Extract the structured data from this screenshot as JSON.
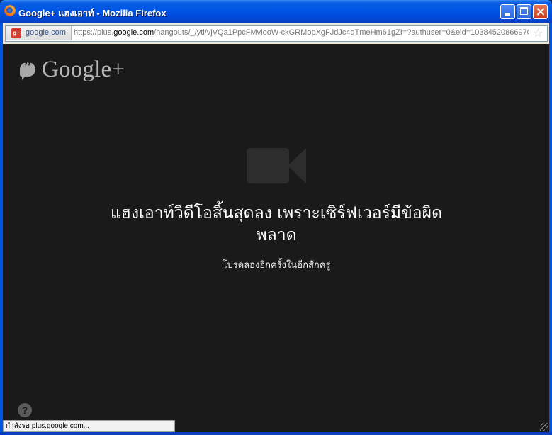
{
  "window": {
    "title": "Google+ แฮงเอาท์ - Mozilla Firefox",
    "minimize_icon": "minimize-icon",
    "maximize_icon": "maximize-icon",
    "close_icon": "close-icon"
  },
  "urlbar": {
    "site_identity": "google.com",
    "url_prefix": "https://plus.",
    "url_domain": "google.com",
    "url_suffix": "/hangouts/_/ytl/vjVQa1PpcFMvlooW-ckGRMopXgFJdJc4qTmeHm61gZI=?authuser=0&eid=103845208669705",
    "favicon_icon": "google-plus-favicon",
    "bookmark_icon": "star-icon"
  },
  "content": {
    "logo_text": "Google+",
    "logo_icon": "hangouts-quote-icon",
    "camera_icon": "video-camera-icon",
    "headline": "แฮงเอาท์วิดีโอสิ้นสุดลง เพราะเซิร์ฟเวอร์มีข้อผิดพลาด",
    "subline": "โปรดลองอีกครั้งในอีกสักครู่",
    "help_icon": "question-mark-icon",
    "help_glyph": "?"
  },
  "status_bar": {
    "text": "กำลังรอ plus.google.com..."
  },
  "colors": {
    "titlebar": "#0055e5",
    "content_bg": "#1a1a1a",
    "headline": "#ffffff",
    "logo": "#b8b8b8"
  }
}
